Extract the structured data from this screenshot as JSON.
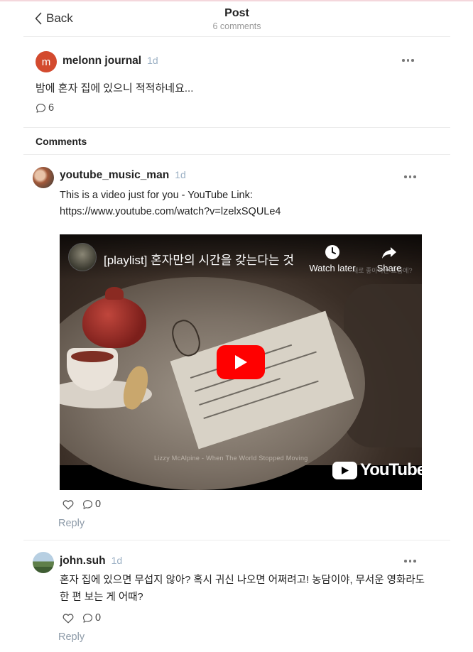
{
  "header": {
    "back_label": "Back",
    "title": "Post",
    "subtitle": "6 comments"
  },
  "post": {
    "avatar_letter": "m",
    "author": "melonn journal",
    "time": "1d",
    "text": "밤에 혼자 집에 있으니 적적하네요...",
    "comment_count": "6"
  },
  "comments_heading": "Comments",
  "comments": [
    {
      "author": "youtube_music_man",
      "time": "1d",
      "text_line1": "This is a video just for you - YouTube Link:",
      "text_line2": "https://www.youtube.com/watch?v=lzelxSQULe4",
      "video": {
        "title": "[playlist] 혼자만의 시간을 갖는다는 것",
        "watch_later": "Watch later",
        "share": "Share",
        "caption": "Lizzy McAlpine - When The World Stopped Moving",
        "logo_text": "YouTube",
        "faint_text": "새로 좋아하는 요즘에?"
      },
      "reply_count": "0",
      "reply_label": "Reply"
    },
    {
      "author": "john.suh",
      "time": "1d",
      "text_line1": "혼자 집에 있으면 무섭지 않아? 혹시 귀신 나오면 어쩌려고! 농담이야, 무서운 영화라도",
      "text_line2": "한 편 보는 게 어때?",
      "reply_count": "0",
      "reply_label": "Reply"
    }
  ],
  "colors": {
    "avatar_m": "#d34a2e",
    "time": "#9bb0c4",
    "reply": "#8d9aa8",
    "youtube_red": "#ff0000"
  },
  "icons": [
    "chevron-left-icon",
    "more-icon",
    "comment-bubble-icon",
    "heart-icon",
    "clock-icon",
    "share-arrow-icon",
    "play-icon",
    "youtube-logo-icon"
  ]
}
